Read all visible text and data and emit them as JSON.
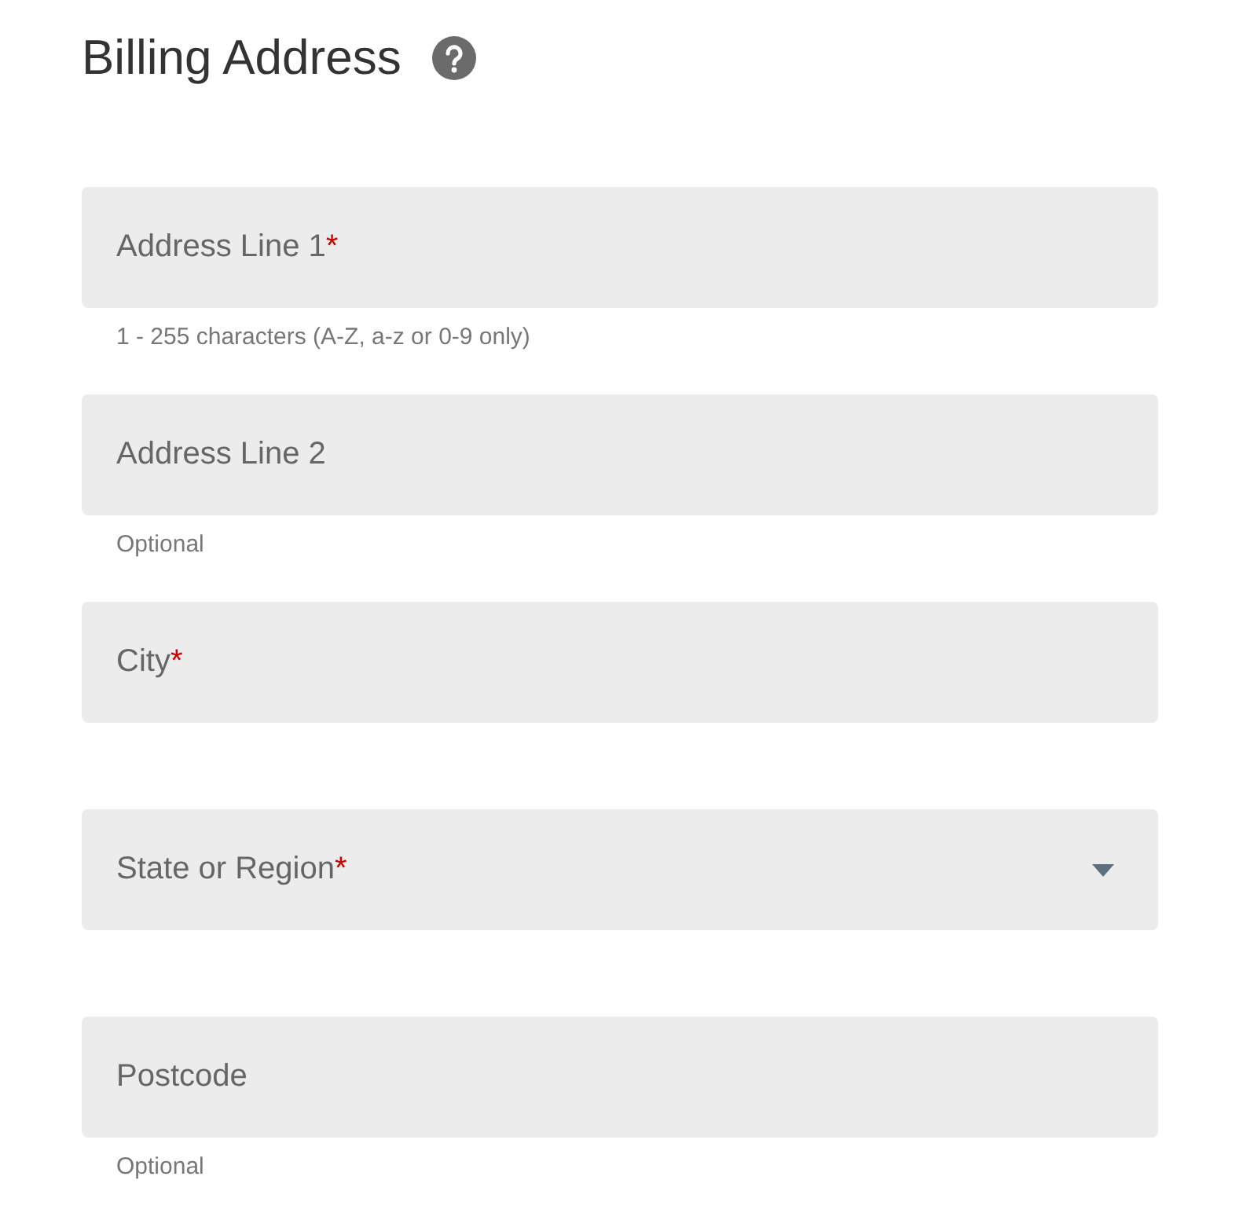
{
  "title": "Billing Address",
  "fields": [
    {
      "kind": "text",
      "label": "Address Line 1",
      "required_mark": "*",
      "helper": "1 - 255 characters (A-Z, a-z or 0-9 only)"
    },
    {
      "kind": "text",
      "label": "Address Line 2",
      "helper": "Optional"
    },
    {
      "kind": "text",
      "label": "City",
      "required_mark": "*"
    },
    {
      "kind": "select",
      "label": "State or Region",
      "required_mark": "*"
    },
    {
      "kind": "text",
      "label": "Postcode",
      "helper": "Optional"
    }
  ]
}
